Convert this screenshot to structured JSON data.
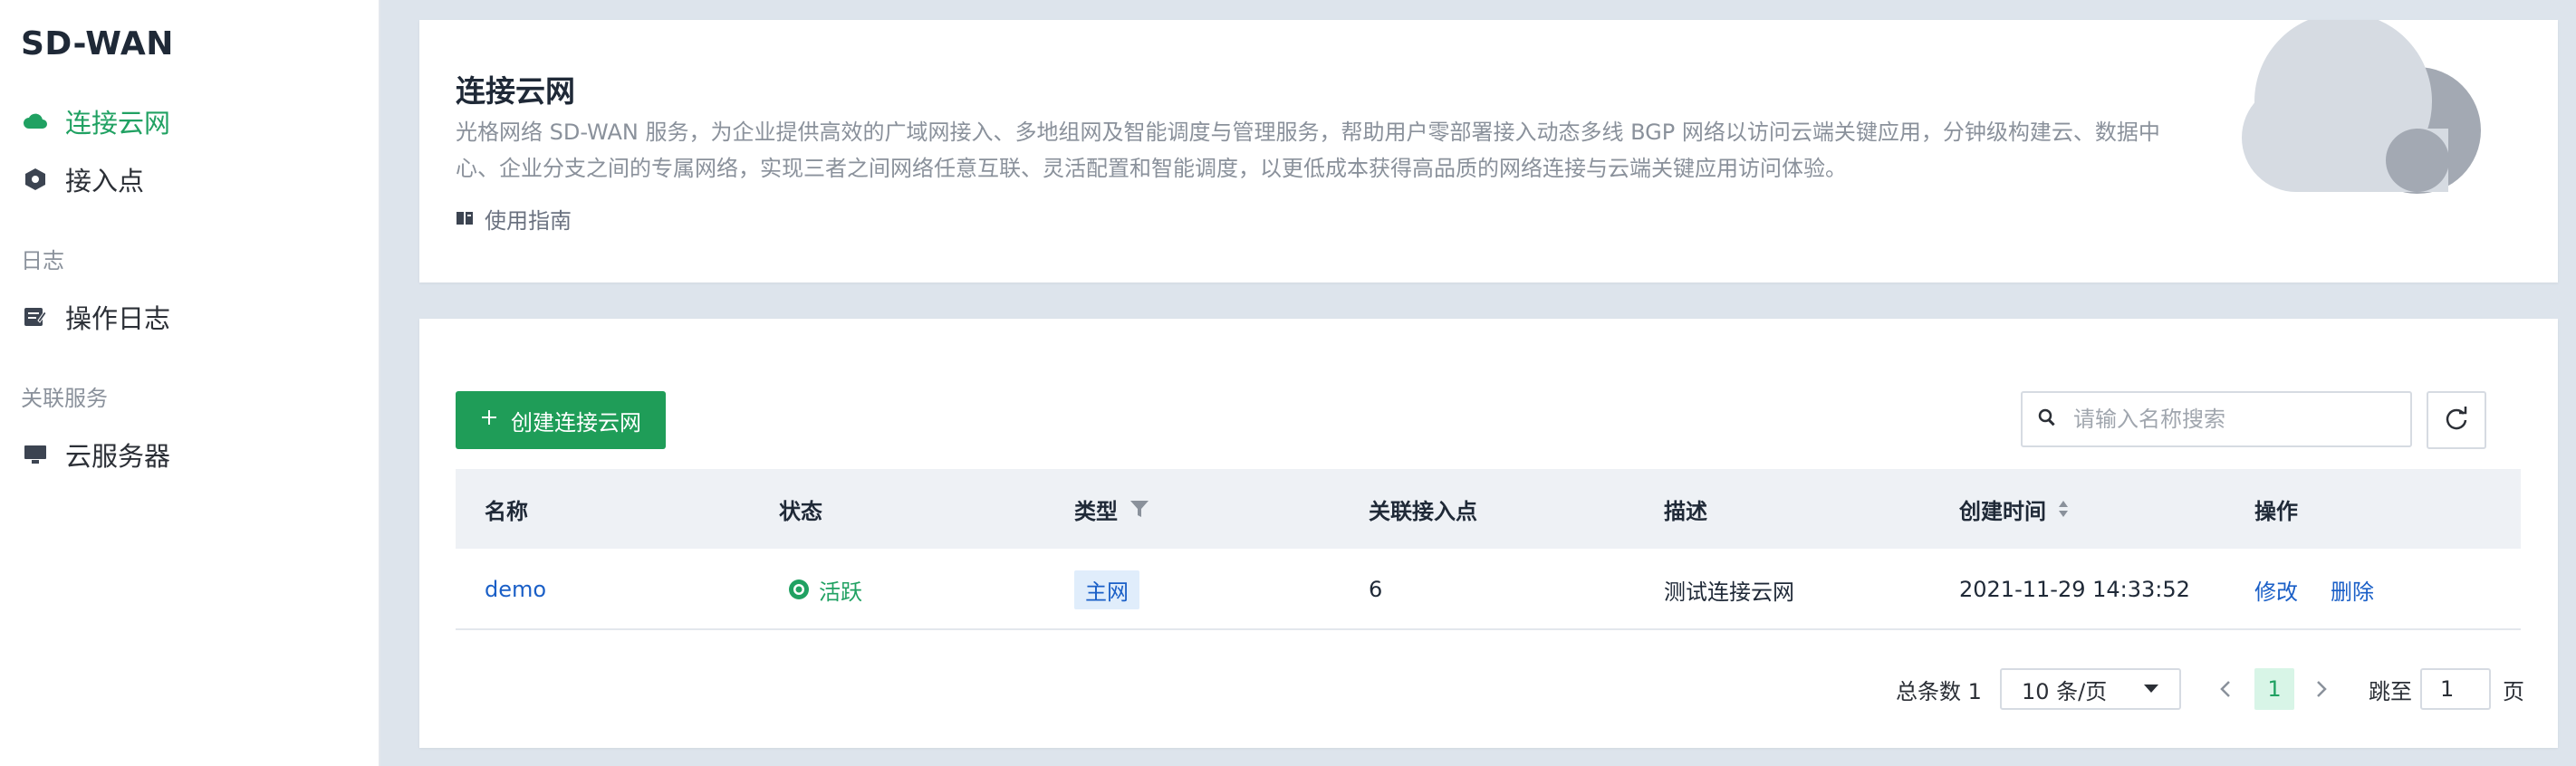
{
  "sidebar": {
    "brand": "SD-WAN",
    "items": [
      {
        "label": "连接云网",
        "icon": "cloud-icon",
        "active": true
      },
      {
        "label": "接入点",
        "icon": "access-point-icon",
        "active": false
      }
    ],
    "groups": [
      {
        "title": "日志",
        "items": [
          {
            "label": "操作日志",
            "icon": "log-icon"
          }
        ]
      },
      {
        "title": "关联服务",
        "items": [
          {
            "label": "云服务器",
            "icon": "monitor-icon"
          }
        ]
      }
    ]
  },
  "intro": {
    "title": "连接云网",
    "description_line1": "光格网络 SD-WAN 服务，为企业提供高效的广域网接入、多地组网及智能调度与管理服务，帮助用户零部署接入动态多线 BGP 网络以访问云端关键应用，分钟级构建云、数据中",
    "description_line2": "心、企业分支之间的专属网络，实现三者之间网络任意互联、灵活配置和智能调度，以更低成本获得高品质的网络连接与云端关键应用访问体验。",
    "guide_label": "使用指南"
  },
  "toolbar": {
    "create_label": "创建连接云网",
    "search_placeholder": "请输入名称搜索"
  },
  "table": {
    "headers": {
      "name": "名称",
      "status": "状态",
      "type": "类型",
      "access_points": "关联接入点",
      "description": "描述",
      "created_at": "创建时间",
      "actions": "操作"
    },
    "rows": [
      {
        "name": "demo",
        "status": "活跃",
        "type": "主网",
        "access_points": "6",
        "description": "测试连接云网",
        "created_at": "2021-11-29 14:33:52",
        "edit": "修改",
        "delete": "删除"
      }
    ]
  },
  "pagination": {
    "total_label": "总条数 1",
    "page_size": "10 条/页",
    "current_page": "1",
    "jump_label": "跳至",
    "jump_value": "1",
    "page_unit": "页"
  },
  "colors": {
    "accent_green": "#1f9d58",
    "link_blue": "#1a5fc7",
    "background": "#dde4ec"
  }
}
